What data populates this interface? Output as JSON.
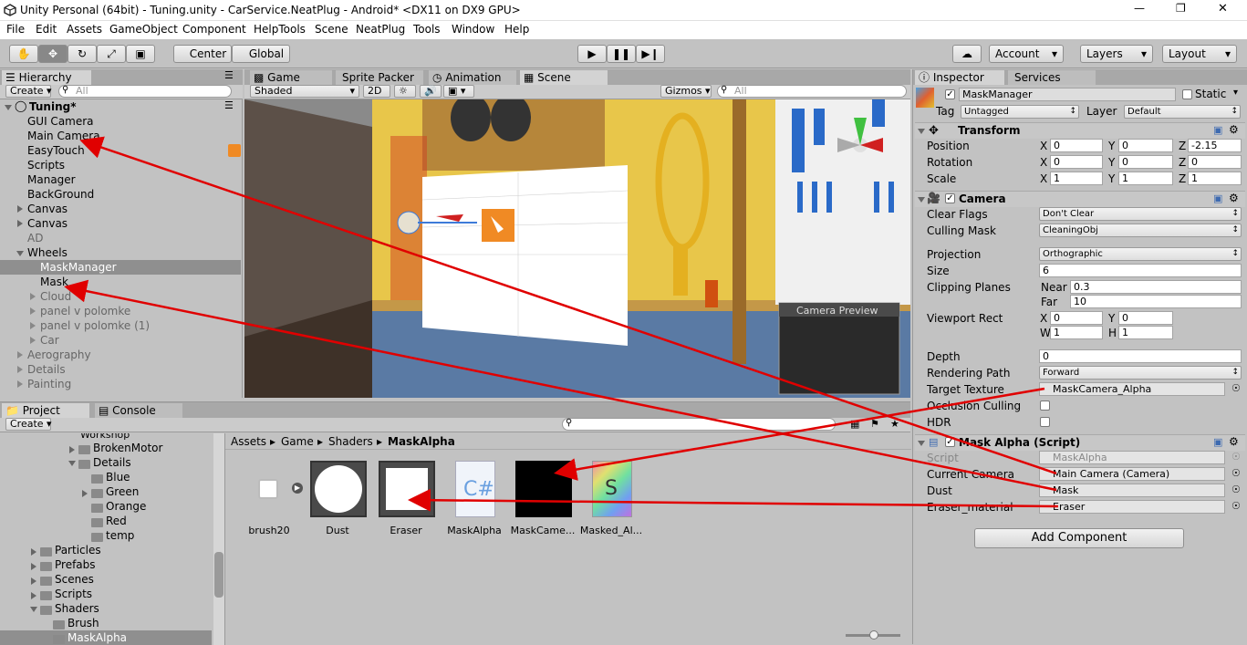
{
  "window": {
    "title": "Unity Personal (64bit) - Tuning.unity - CarService.NeatPlug - Android* <DX11 on DX9 GPU>",
    "min": "—",
    "max": "❐",
    "close": "✕"
  },
  "menu": [
    "File",
    "Edit",
    "Assets",
    "GameObject",
    "Component",
    "HelpTools",
    "Scene",
    "NeatPlug",
    "Tools",
    "Window",
    "Help"
  ],
  "toolbar": {
    "center": "Center",
    "global": "Global",
    "account": "Account",
    "layers": "Layers",
    "layout": "Layout"
  },
  "hierarchy": {
    "tab": "Hierarchy",
    "create": "Create",
    "search": "All",
    "scene": "Tuning*",
    "items": [
      "GUI Camera",
      "Main Camera",
      "EasyTouch",
      "Scripts",
      "Manager",
      "BackGround",
      "Canvas",
      "Canvas",
      "AD",
      "Wheels",
      "MaskManager",
      "Mask",
      "Cloud",
      "panel v polomke",
      "panel v polomke (1)",
      "Car",
      "Aerography",
      "Details",
      "Painting"
    ]
  },
  "scene": {
    "tabs": [
      "Game",
      "Sprite Packer",
      "Animation",
      "Scene"
    ],
    "shaded": "Shaded",
    "mode2d": "2D",
    "gizmos": "Gizmos",
    "search": "All",
    "preview": "Camera Preview"
  },
  "project": {
    "tabs": [
      "Project",
      "Console"
    ],
    "create": "Create",
    "tree": [
      "Workshop",
      "BrokenMotor",
      "Details",
      "Blue",
      "Green",
      "Orange",
      "Red",
      "temp",
      "Particles",
      "Prefabs",
      "Scenes",
      "Scripts",
      "Shaders",
      "Brush",
      "MaskAlpha"
    ],
    "breadcrumb": [
      "Assets",
      "Game",
      "Shaders",
      "MaskAlpha"
    ],
    "assets": [
      "brush20",
      "Dust",
      "Eraser",
      "MaskAlpha",
      "MaskCame...",
      "Masked_Al..."
    ]
  },
  "inspector": {
    "tabs": [
      "Inspector",
      "Services"
    ],
    "name": "MaskManager",
    "static": "Static",
    "tag_label": "Tag",
    "tag": "Untagged",
    "layer_label": "Layer",
    "layer": "Default",
    "transform": {
      "title": "Transform",
      "position": "Position",
      "rotation": "Rotation",
      "scale": "Scale",
      "px": "0",
      "py": "0",
      "pz": "-2.15",
      "rx": "0",
      "ry": "0",
      "rz": "0",
      "sx": "1",
      "sy": "1",
      "sz": "1"
    },
    "camera": {
      "title": "Camera",
      "clear_flags": "Clear Flags",
      "clear_flags_v": "Don't Clear",
      "culling_mask": "Culling Mask",
      "culling_mask_v": "CleaningObj",
      "projection": "Projection",
      "projection_v": "Orthographic",
      "size": "Size",
      "size_v": "6",
      "clipping": "Clipping Planes",
      "near": "Near",
      "near_v": "0.3",
      "far": "Far",
      "far_v": "10",
      "viewport": "Viewport Rect",
      "vx": "0",
      "vy": "0",
      "vw": "1",
      "vh": "1",
      "depth": "Depth",
      "depth_v": "0",
      "rendering": "Rendering Path",
      "rendering_v": "Forward",
      "target": "Target Texture",
      "target_v": "MaskCamera_Alpha",
      "occlusion": "Occlusion Culling",
      "hdr": "HDR"
    },
    "script": {
      "title": "Mask Alpha (Script)",
      "script": "Script",
      "script_v": "MaskAlpha",
      "current_camera": "Current Camera",
      "current_camera_v": "Main Camera (Camera)",
      "dust": "Dust",
      "dust_v": "Mask",
      "eraser": "Eraser_material",
      "eraser_v": "Eraser"
    },
    "add_component": "Add Component"
  },
  "axes": {
    "x": "X",
    "y": "Y",
    "z": "Z",
    "w": "W",
    "h": "H"
  },
  "colors": {
    "annotation": "#e00000",
    "selection": "#8f8f8f",
    "accent": "#3d7bd9"
  }
}
